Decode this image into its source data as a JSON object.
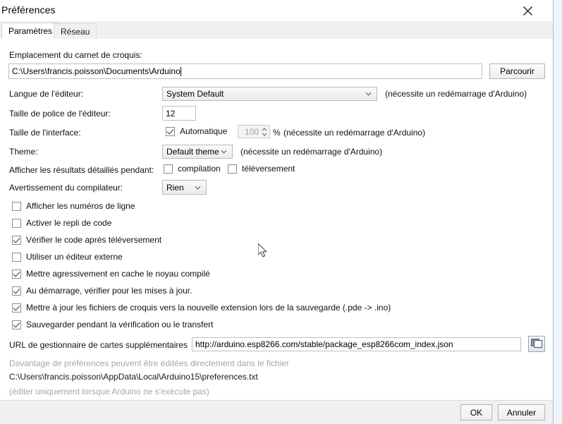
{
  "window": {
    "title": "Préférences",
    "close_icon": "close-icon"
  },
  "tabs": [
    {
      "label": "Paramètres",
      "active": true
    },
    {
      "label": "Réseau",
      "active": false
    }
  ],
  "settings": {
    "sketchbook": {
      "label": "Emplacement du carnet de croquis:",
      "value": "C:\\Users\\francis.poisson\\Documents\\Arduino",
      "browse_label": "Parcourir"
    },
    "language": {
      "label": "Langue de l'éditeur:",
      "value": "System Default",
      "note": "(nécessite un redémarrage d'Arduino)"
    },
    "font_size": {
      "label": "Taille de police de l'éditeur:",
      "value": "12"
    },
    "interface_scale": {
      "label": "Taille de l'interface:",
      "auto_label": "Automatique",
      "auto_checked": true,
      "value": "100",
      "unit": "%",
      "note": "(nécessite un redémarrage d'Arduino)"
    },
    "theme": {
      "label": "Theme:",
      "value": "Default theme",
      "note": "(nécessite un redémarrage d'Arduino)"
    },
    "verbose": {
      "label": "Afficher les résultats détaillés pendant:",
      "compile_label": "compilation",
      "compile_checked": false,
      "upload_label": "téléversement",
      "upload_checked": false
    },
    "compiler_warnings": {
      "label": "Avertissement du compilateur:",
      "value": "Rien"
    }
  },
  "checkboxes": [
    {
      "label": "Afficher les numéros de ligne",
      "checked": false
    },
    {
      "label": "Activer le repli de code",
      "checked": false
    },
    {
      "label": "Vérifier le code après téléversement",
      "checked": true
    },
    {
      "label": "Utiliser un éditeur externe",
      "checked": false
    },
    {
      "label": "Mettre agressivement en cache le noyau compilé",
      "checked": true
    },
    {
      "label": "Au démarrage, vérifier pour les mises à jour.",
      "checked": true
    },
    {
      "label": "Mettre à jour les fichiers de croquis vers la nouvelle extension lors de la sauvegarde (.pde -> .ino)",
      "checked": true
    },
    {
      "label": "Sauvegarder pendant la vérification ou le transfert",
      "checked": true
    }
  ],
  "urls": {
    "label": "URL de gestionnaire de cartes supplémentaires",
    "value": "http://arduino.esp8266.com/stable/package_esp8266com_index.json",
    "icon": "open-window-icon"
  },
  "footer_info": {
    "line1": "Davantage de préférences peuvent être éditées directement dans le fichier",
    "line2": "C:\\Users\\francis.poisson\\AppData\\Local\\Arduino15\\preferences.txt",
    "line3": "(éditer uniquement lorsque Arduino ne s'exécute pas)"
  },
  "footer_buttons": {
    "ok_label": "OK",
    "cancel_label": "Annuler"
  },
  "colors": {
    "panel_bg": "#ffffff",
    "chrome_bg": "#f0f0f0",
    "accent_border": "#9fc6e8",
    "muted_text": "#a6a6a6"
  }
}
